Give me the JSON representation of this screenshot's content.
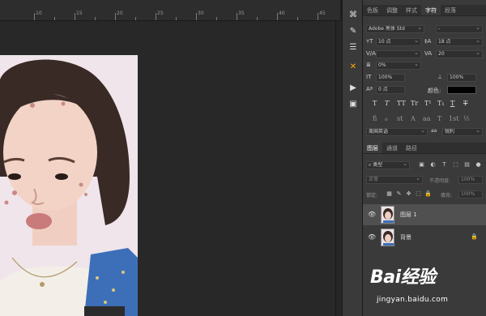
{
  "ruler": {
    "labels": [
      "10",
      "15",
      "20",
      "25",
      "30",
      "35",
      "40",
      "45"
    ]
  },
  "character_panel": {
    "tabs": [
      {
        "label": "色板",
        "active": false
      },
      {
        "label": "调整",
        "active": false
      },
      {
        "label": "样式",
        "active": false
      },
      {
        "label": "字符",
        "active": true
      },
      {
        "label": "段落",
        "active": false
      }
    ],
    "font_family": "Adobe 黑体 Std",
    "font_style": "-",
    "font_size": "10 点",
    "leading": "18 点",
    "kerning": "",
    "tracking": "20",
    "scale_pct": "0%",
    "vertical_scale": "100%",
    "horizontal_scale": "100%",
    "baseline_shift": "0 点",
    "color_label": "颜色:",
    "color_value": "#000000",
    "style_glyphs": [
      "T",
      "T",
      "TT",
      "Tr",
      "T¹",
      "T₁",
      "T",
      "T"
    ],
    "opentype_glyphs": [
      "fi",
      "ℴ",
      "st",
      "A",
      "aa",
      "T",
      "1st",
      "½"
    ],
    "language": "美国英语",
    "antialias_icon": "aa",
    "antialias": "锐利"
  },
  "layers_panel": {
    "tabs": [
      {
        "label": "图层",
        "active": true
      },
      {
        "label": "通道",
        "active": false
      },
      {
        "label": "路径",
        "active": false
      }
    ],
    "filter_label": "类型",
    "blend_mode": "正常",
    "opacity_label": "不透明度:",
    "opacity": "100%",
    "lock_label": "锁定:",
    "fill_label": "填充:",
    "fill": "100%",
    "layers": [
      {
        "name": "图层 1",
        "selected": true,
        "visible": true,
        "locked": false
      },
      {
        "name": "背景",
        "selected": false,
        "visible": true,
        "locked": true
      }
    ]
  },
  "watermark": {
    "logo_text": "Bai经验",
    "url": "jingyan.baidu.com"
  },
  "colors": {
    "canvas_bg": "#282828",
    "panel_bg": "#3a3a3a",
    "active_tool": "#ffb000",
    "denim": "#3d6fb8"
  }
}
